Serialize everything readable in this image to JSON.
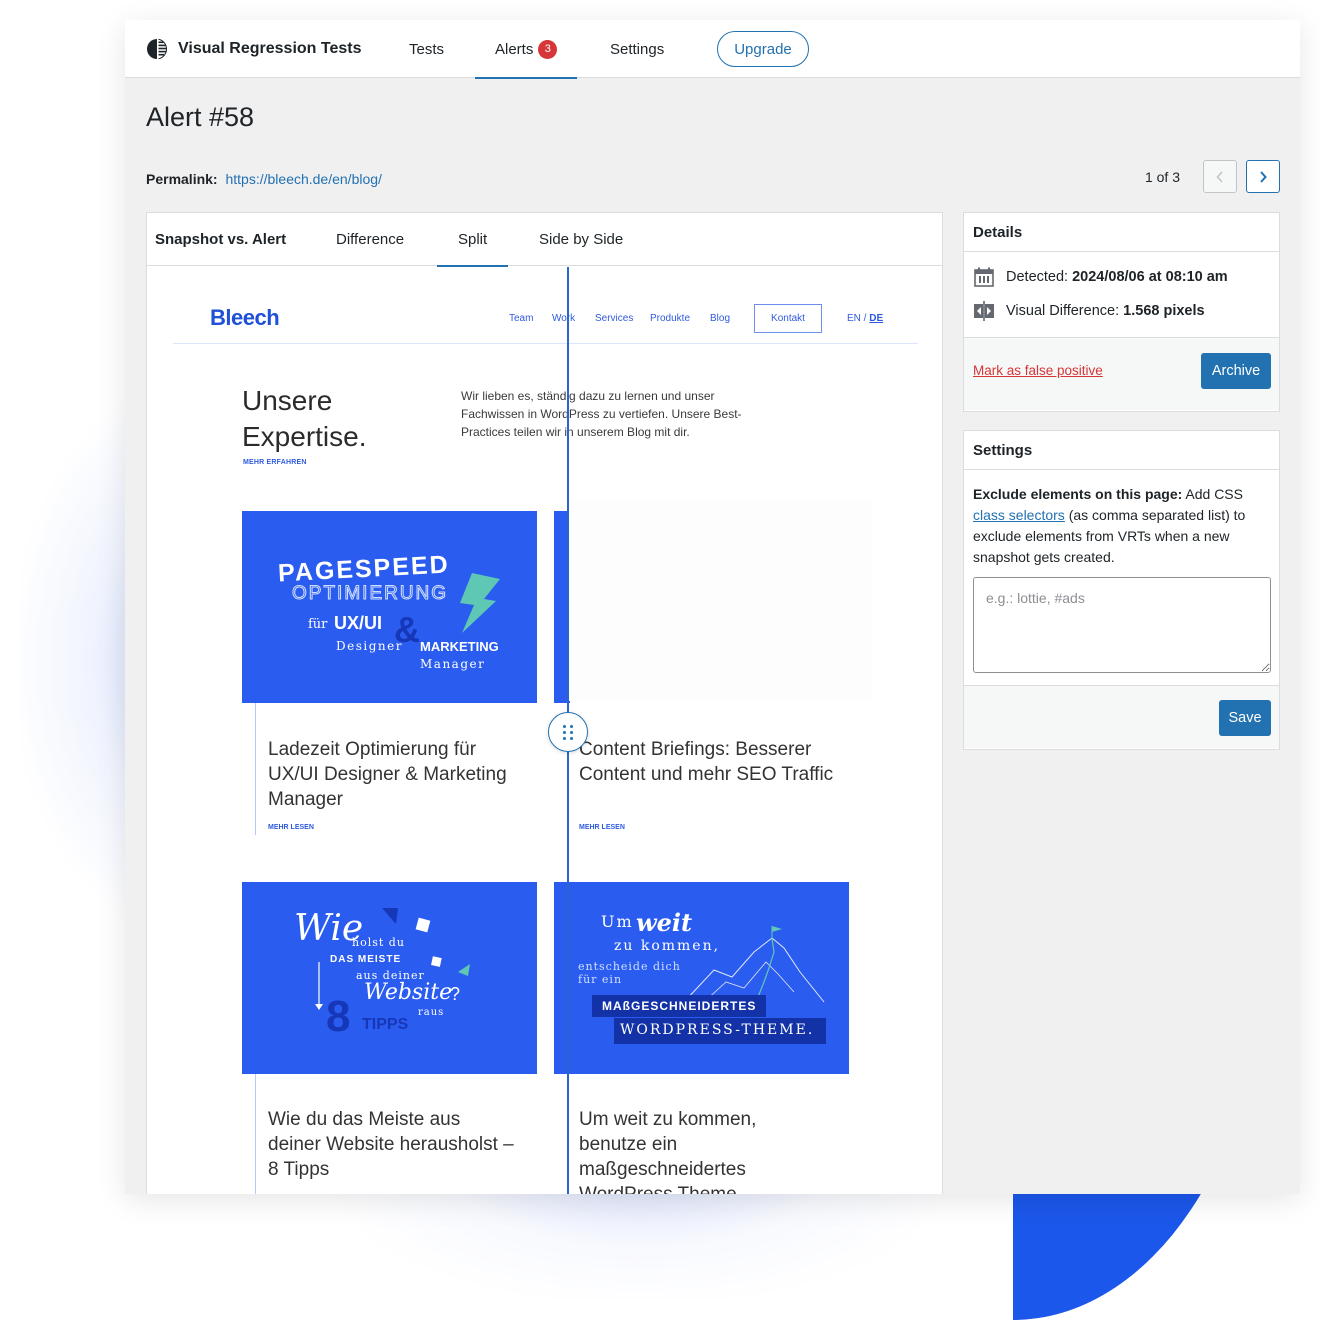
{
  "header": {
    "app_title": "Visual Regression Tests",
    "brand_icon": "half-circle-logo-icon",
    "nav": [
      {
        "label": "Tests",
        "active": false
      },
      {
        "label": "Alerts",
        "active": true,
        "badge": "3"
      },
      {
        "label": "Settings",
        "active": false
      }
    ],
    "upgrade_label": "Upgrade"
  },
  "page": {
    "title": "Alert #58",
    "permalink_label": "Permalink:",
    "permalink_url": "https://bleech.de/en/blog/",
    "pager": {
      "count": "1 of 3",
      "prev_icon": "chevron-left-icon",
      "next_icon": "chevron-right-icon"
    }
  },
  "viewer": {
    "title": "Snapshot vs. Alert",
    "tabs": [
      {
        "label": "Difference",
        "active": false
      },
      {
        "label": "Split",
        "active": true
      },
      {
        "label": "Side by Side",
        "active": false
      }
    ],
    "split_handle_icon": "drag-handle-icon"
  },
  "site": {
    "logo": "Bleech",
    "nav": [
      "Team",
      "Work",
      "Services",
      "Produkte",
      "Blog"
    ],
    "contact": "Kontakt",
    "lang_en": "EN",
    "lang_sep": " / ",
    "lang_de": "DE",
    "hero_title_line1": "Unsere",
    "hero_title_line2": "Expertise.",
    "hero_more": "MEHR ERFAHREN",
    "hero_text": "Wir lieben es, ständig dazu zu lernen und unser Fachwissen in WordPress zu vertiefen. Unsere Best-Practices teilen wir in unserem Blog mit dir.",
    "cards": [
      {
        "title": "Ladezeit Optimierung für UX/UI Designer & Marketing Manager",
        "more": "MEHR LESEN",
        "image_text": [
          "PAGESPEED",
          "OPTIMIERUNG",
          "für",
          "UX/UI",
          "Designer",
          "&",
          "MARKETING",
          "Manager"
        ]
      },
      {
        "title": "Content Briefings: Besserer Content und mehr SEO Traffic",
        "more": "MEHR LESEN"
      },
      {
        "title": "Wie du das Meiste aus deiner Website herausholst – 8 Tipps",
        "image_text": [
          "Wie",
          "holst du",
          "DAS MEISTE",
          "aus deiner",
          "Website",
          "raus",
          "8",
          "TIPPS",
          "?"
        ]
      },
      {
        "title": "Um weit zu kommen, benutze ein maßgeschneidertes WordPress Theme",
        "image_text": [
          "Um",
          "weit",
          "zu kommen,",
          "entscheide dich",
          "für ein",
          "MAßGESCHNEIDERTES",
          "WORDPRESS-THEME."
        ]
      }
    ]
  },
  "details": {
    "title": "Details",
    "detected_label": "Detected:",
    "detected_value": "2024/08/06 at 08:10 am",
    "diff_label": "Visual Difference:",
    "diff_value": "1.568 pixels",
    "false_positive": "Mark as false positive",
    "archive": "Archive"
  },
  "settings": {
    "title": "Settings",
    "exclude_label": "Exclude elements on this page:",
    "text_1": " Add CSS ",
    "link": "class selectors",
    "text_2": " (as comma separated list) to exclude elements from VRTs when a new snapshot gets created.",
    "placeholder": "e.g.: lottie, #ads",
    "value": "",
    "save": "Save"
  },
  "colors": {
    "accent": "#2271b1",
    "danger": "#d63638",
    "site_blue": "#2b5cf0",
    "decor_blue": "#1b57ea"
  }
}
